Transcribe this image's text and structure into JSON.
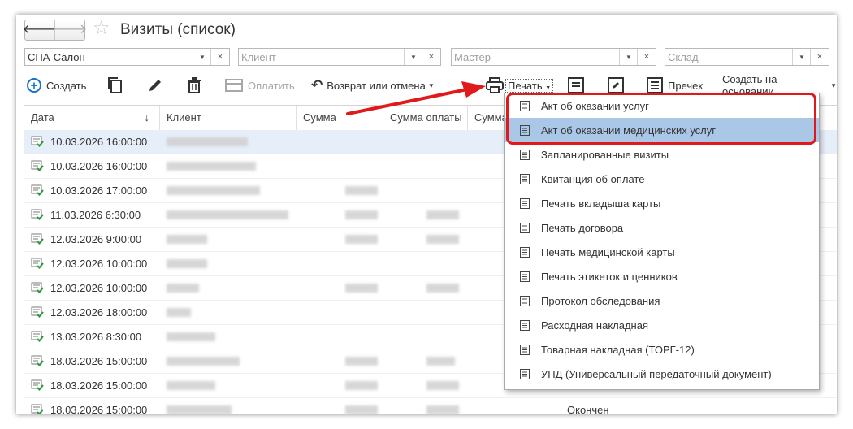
{
  "window": {
    "title": "Визиты (список)"
  },
  "filters": [
    {
      "value": "СПА-Салон",
      "placeholder": ""
    },
    {
      "value": "",
      "placeholder": "Клиент"
    },
    {
      "value": "",
      "placeholder": "Мастер"
    },
    {
      "value": "",
      "placeholder": "Склад"
    }
  ],
  "toolbar": {
    "create": "Создать",
    "pay": "Оплатить",
    "return": "Возврат или отмена",
    "print": "Печать",
    "receipt": "Пречек",
    "create_based": "Создать на основании"
  },
  "table": {
    "columns": [
      "Дата",
      "Клиент",
      "Сумма",
      "Сумма оплаты",
      "Сумма"
    ],
    "sort_indicator": "↓",
    "rows": [
      {
        "date": "10.03.2026 16:00:00",
        "status": ""
      },
      {
        "date": "10.03.2026 16:00:00",
        "status": ""
      },
      {
        "date": "10.03.2026 17:00:00",
        "status": ""
      },
      {
        "date": "11.03.2026 6:30:00",
        "status": ""
      },
      {
        "date": "12.03.2026 9:00:00",
        "status": ""
      },
      {
        "date": "12.03.2026 10:00:00",
        "status": ""
      },
      {
        "date": "12.03.2026 10:00:00",
        "status": ""
      },
      {
        "date": "12.03.2026 18:00:00",
        "status": ""
      },
      {
        "date": "13.03.2026 8:30:00",
        "status": ""
      },
      {
        "date": "18.03.2026 15:00:00",
        "status": ""
      },
      {
        "date": "18.03.2026 15:00:00",
        "status": ""
      },
      {
        "date": "18.03.2026 15:00:00",
        "status": "Окончен"
      }
    ]
  },
  "print_menu": {
    "items": [
      "Акт об оказании услуг",
      "Акт об оказании медицинских услуг",
      "Запланированные визиты",
      "Квитанция об оплате",
      "Печать вкладыша карты",
      "Печать договора",
      "Печать медицинской карты",
      "Печать этикеток и ценников",
      "Протокол обследования",
      "Расходная накладная",
      "Товарная накладная (ТОРГ-12)",
      "УПД (Универсальный передаточный документ)"
    ],
    "highlighted_index": 1
  },
  "colors": {
    "accent": "#1e73c8",
    "highlight": "#aac7e8",
    "annotation": "#e01a1a",
    "doc_icon": "#2a9a3a"
  }
}
